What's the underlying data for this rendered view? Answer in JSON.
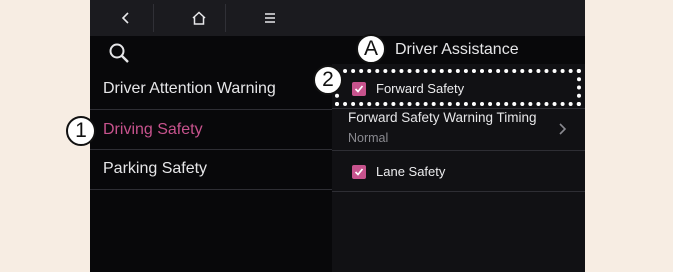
{
  "topbar": {
    "back_icon": "back-chevron-icon",
    "home_icon": "home-icon",
    "menu_icon": "menu-icon"
  },
  "search": {
    "icon": "search-icon"
  },
  "left_menu": {
    "items": [
      {
        "label": "Driver Attention Warning",
        "active": false
      },
      {
        "label": "Driving Safety",
        "active": true
      },
      {
        "label": "Parking Safety",
        "active": false
      }
    ]
  },
  "panel": {
    "title": "Driver Assistance",
    "forward_safety": {
      "label": "Forward Safety",
      "checked": true
    },
    "warning_timing": {
      "title": "Forward Safety Warning Timing",
      "value": "Normal"
    },
    "lane_safety": {
      "label": "Lane Safety",
      "checked": true
    }
  },
  "callouts": {
    "a": "A",
    "one": "1",
    "two": "2"
  },
  "colors": {
    "accent": "#c7538d",
    "background": "#08080a",
    "page": "#f7ede3"
  }
}
